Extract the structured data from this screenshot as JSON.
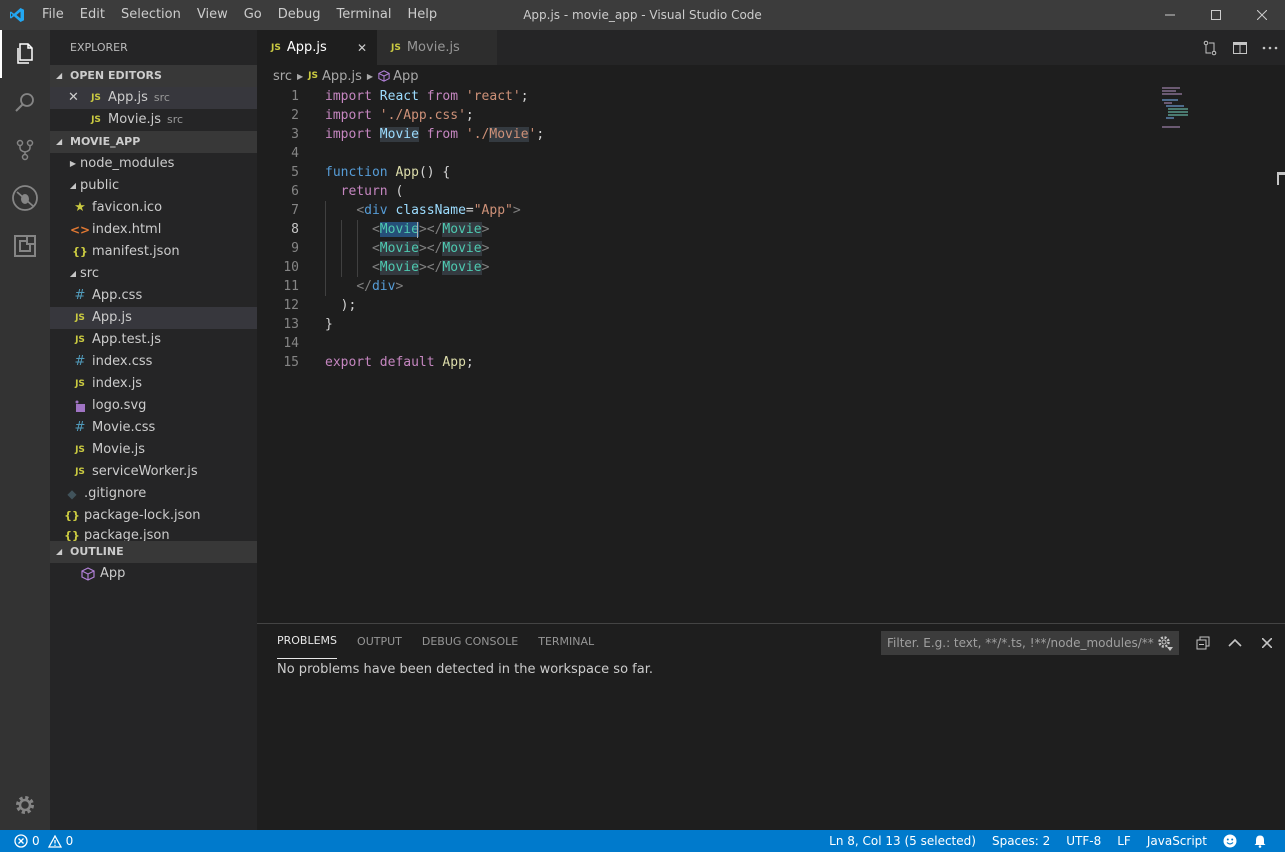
{
  "window": {
    "title": "App.js - movie_app - Visual Studio Code",
    "menu": [
      "File",
      "Edit",
      "Selection",
      "View",
      "Go",
      "Debug",
      "Terminal",
      "Help"
    ]
  },
  "activity_bar": {
    "icons": [
      "files-icon",
      "search-icon",
      "source-control-icon",
      "debug-icon",
      "extensions-icon",
      "settings-gear-icon"
    ]
  },
  "sidebar": {
    "title": "EXPLORER",
    "open_editors": {
      "header": "OPEN EDITORS",
      "items": [
        {
          "label": "App.js",
          "sub": "src",
          "icon": "JS"
        },
        {
          "label": "Movie.js",
          "sub": "src",
          "icon": "JS"
        }
      ]
    },
    "project": {
      "header": "MOVIE_APP",
      "items": [
        {
          "label": "node_modules",
          "type": "folder-collapsed"
        },
        {
          "label": "public",
          "type": "folder-expanded"
        },
        {
          "label": "favicon.ico",
          "icon": "★"
        },
        {
          "label": "index.html",
          "icon": "<>"
        },
        {
          "label": "manifest.json",
          "icon": "{}"
        },
        {
          "label": "src",
          "type": "folder-expanded"
        },
        {
          "label": "App.css",
          "icon": "#"
        },
        {
          "label": "App.js",
          "icon": "JS"
        },
        {
          "label": "App.test.js",
          "icon": "JS"
        },
        {
          "label": "index.css",
          "icon": "#"
        },
        {
          "label": "index.js",
          "icon": "JS"
        },
        {
          "label": "logo.svg",
          "icon": "svg"
        },
        {
          "label": "Movie.css",
          "icon": "#"
        },
        {
          "label": "Movie.js",
          "icon": "JS"
        },
        {
          "label": "serviceWorker.js",
          "icon": "JS"
        },
        {
          "label": ".gitignore",
          "icon": "◆"
        },
        {
          "label": "package-lock.json",
          "icon": "{}"
        },
        {
          "label": "package.json",
          "icon": "{}"
        }
      ]
    },
    "outline": {
      "header": "OUTLINE",
      "items": [
        "App"
      ]
    }
  },
  "editor": {
    "tabs": [
      {
        "label": "App.js",
        "icon": "JS",
        "active": true
      },
      {
        "label": "Movie.js",
        "icon": "JS",
        "active": false
      }
    ],
    "breadcrumb": [
      "src",
      "App.js",
      "App"
    ],
    "line_numbers": [
      "1",
      "2",
      "3",
      "4",
      "5",
      "6",
      "7",
      "8",
      "9",
      "10",
      "11",
      "12",
      "13",
      "14",
      "15"
    ],
    "current_line": 8
  },
  "panel": {
    "tabs": [
      "PROBLEMS",
      "OUTPUT",
      "DEBUG CONSOLE",
      "TERMINAL"
    ],
    "filter_placeholder": "Filter. E.g.: text, **/*.ts, !**/node_modules/**",
    "message": "No problems have been detected in the workspace so far."
  },
  "status_bar": {
    "errors": "0",
    "warnings": "0",
    "position": "Ln 8, Col 13 (5 selected)",
    "spaces": "Spaces: 2",
    "encoding": "UTF-8",
    "eol": "LF",
    "language": "JavaScript"
  },
  "colors": {
    "accent": "#007acc",
    "titlebar": "#3c3c3c",
    "sidebar": "#252526",
    "editor": "#1e1e1e"
  }
}
